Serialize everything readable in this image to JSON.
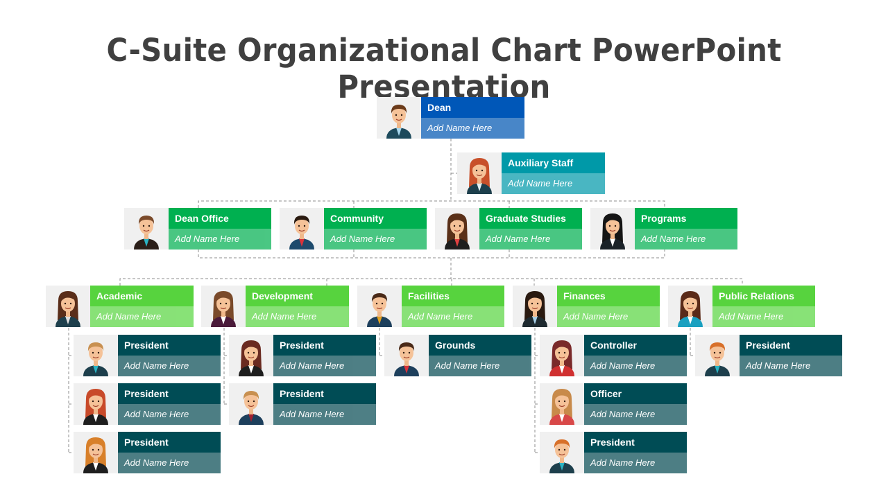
{
  "title": "C-Suite Organizational Chart PowerPoint Presentation",
  "placeholder_name": "Add Name Here",
  "colors": {
    "dean": [
      "#0057b8",
      "#3f80c6"
    ],
    "auxiliary": [
      "#0099a8",
      "#40b3bf"
    ],
    "level2": [
      "#00b050",
      "#40c47c"
    ],
    "level3": [
      "#57d33e",
      "#82e070"
    ],
    "level4": [
      "#004c55",
      "#44787e"
    ]
  },
  "nodes": {
    "dean": {
      "role": "Dean",
      "name": "Add Name Here"
    },
    "auxiliary": {
      "role": "Auxiliary Staff",
      "name": "Add Name Here"
    },
    "dean_office": {
      "role": "Dean Office",
      "name": "Add Name Here"
    },
    "community": {
      "role": "Community",
      "name": "Add Name Here"
    },
    "graduate_studies": {
      "role": "Graduate Studies",
      "name": "Add Name Here"
    },
    "programs": {
      "role": "Programs",
      "name": "Add Name Here"
    },
    "academic": {
      "role": "Academic",
      "name": "Add Name Here"
    },
    "development": {
      "role": "Development",
      "name": "Add Name Here"
    },
    "facilities": {
      "role": "Facilities",
      "name": "Add Name Here"
    },
    "finances": {
      "role": "Finances",
      "name": "Add Name Here"
    },
    "public_relations": {
      "role": "Public Relations",
      "name": "Add Name Here"
    },
    "academic_1": {
      "role": "President",
      "name": "Add Name Here"
    },
    "academic_2": {
      "role": "President",
      "name": "Add Name Here"
    },
    "academic_3": {
      "role": "President",
      "name": "Add Name Here"
    },
    "development_1": {
      "role": "President",
      "name": "Add Name Here"
    },
    "development_2": {
      "role": "President",
      "name": "Add Name Here"
    },
    "facilities_1": {
      "role": "Grounds",
      "name": "Add Name Here"
    },
    "finances_1": {
      "role": "Controller",
      "name": "Add Name Here"
    },
    "finances_2": {
      "role": "Officer",
      "name": "Add Name Here"
    },
    "finances_3": {
      "role": "President",
      "name": "Add Name Here"
    },
    "public_relations_1": {
      "role": "President",
      "name": "Add Name Here"
    }
  }
}
